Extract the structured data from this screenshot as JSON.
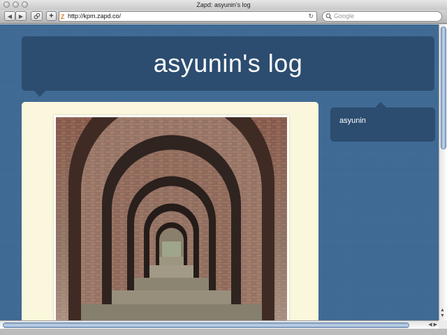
{
  "window": {
    "title": "Zapd: asyunin's log"
  },
  "toolbar": {
    "back_glyph": "◀",
    "forward_glyph": "▶",
    "add_bookmark_glyph": "+",
    "url": "http://kpm.zapd.co/",
    "favicon_glyph": "Z",
    "reload_glyph": "↻",
    "search_placeholder": "Google",
    "search_glyph": "🔍"
  },
  "page": {
    "blog_title": "asyunin's log",
    "sidebar": {
      "author": "asyunin"
    },
    "post": {
      "image_subject": "brick-arch-tunnel-photo"
    },
    "colors": {
      "background": "#3e6a94",
      "header_box": "#2c4d70",
      "post_box": "#fbf7dc",
      "title_text": "#ffffff"
    }
  }
}
